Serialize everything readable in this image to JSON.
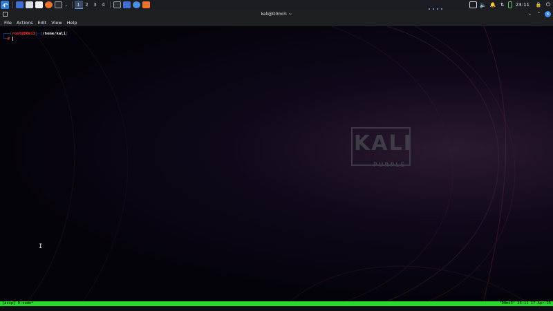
{
  "taskbar": {
    "workspaces": [
      "1",
      "2",
      "3",
      "4"
    ],
    "active_workspace": "1",
    "clock": "23:11",
    "launchers": [
      "kali-menu-icon",
      "desktop-icon",
      "file-manager-icon",
      "text-editor-icon",
      "firefox-icon",
      "terminal-icon",
      "terminal-window-icon",
      "files-window-icon",
      "browser-window-icon",
      "burp-icon"
    ]
  },
  "window": {
    "title": "kali@D0mi3: ~",
    "menu": [
      "File",
      "Actions",
      "Edit",
      "View",
      "Help"
    ]
  },
  "terminal": {
    "prompt_user": "root@D0mi3",
    "prompt_path": "/home/kali",
    "prompt_symbol": "#",
    "wallpaper_text": "KALI",
    "wallpaper_sub": "PURPLE"
  },
  "tmux": {
    "left": "[ascp] 0:sudo*",
    "right": "\"D0mi3\" 23:11 17-Apr-25"
  },
  "colors": {
    "tmux_bar": "#2dd82d",
    "prompt_red": "#ff3b3b",
    "prompt_blue": "#3b7cff"
  }
}
